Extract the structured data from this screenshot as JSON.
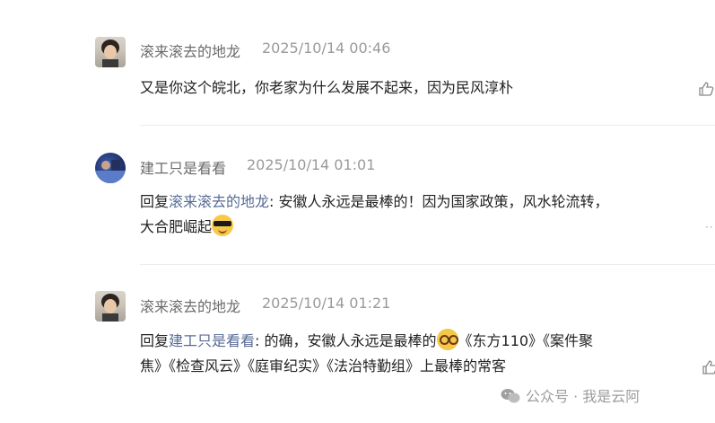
{
  "comments": [
    {
      "username": "滚来滚去的地龙",
      "time": "2025/10/14 00:46",
      "text": "又是你这个皖北，你老家为什么发展不起来，因为民风淳朴"
    },
    {
      "username": "建工只是看看",
      "time": "2025/10/14 01:01",
      "reply_prefix": "回复",
      "reply_to": "滚来滚去的地龙",
      "text_line1": ": 安徽人永远是最棒的！因为国家政策，风水轮流转，",
      "text_line2": "大合肥崛起",
      "emoji": "sunglasses-emoji"
    },
    {
      "username": "滚来滚去的地龙",
      "time": "2025/10/14 01:21",
      "reply_prefix": "回复",
      "reply_to": "建工只是看看",
      "text_line1a": ": 的确，安徽人永远是最棒的",
      "text_line1b": "《东方110》《案件聚",
      "text_line2": "焦》《检查风云》《庭审纪实》《法治特勤组》上最棒的常客",
      "emoji": "nerd-face-emoji"
    }
  ],
  "watermark": "公众号 · 我是云阿",
  "icons": {
    "like": "thumbs-up-icon",
    "more": "more-dots-icon",
    "watermark": "wechat-icon"
  }
}
